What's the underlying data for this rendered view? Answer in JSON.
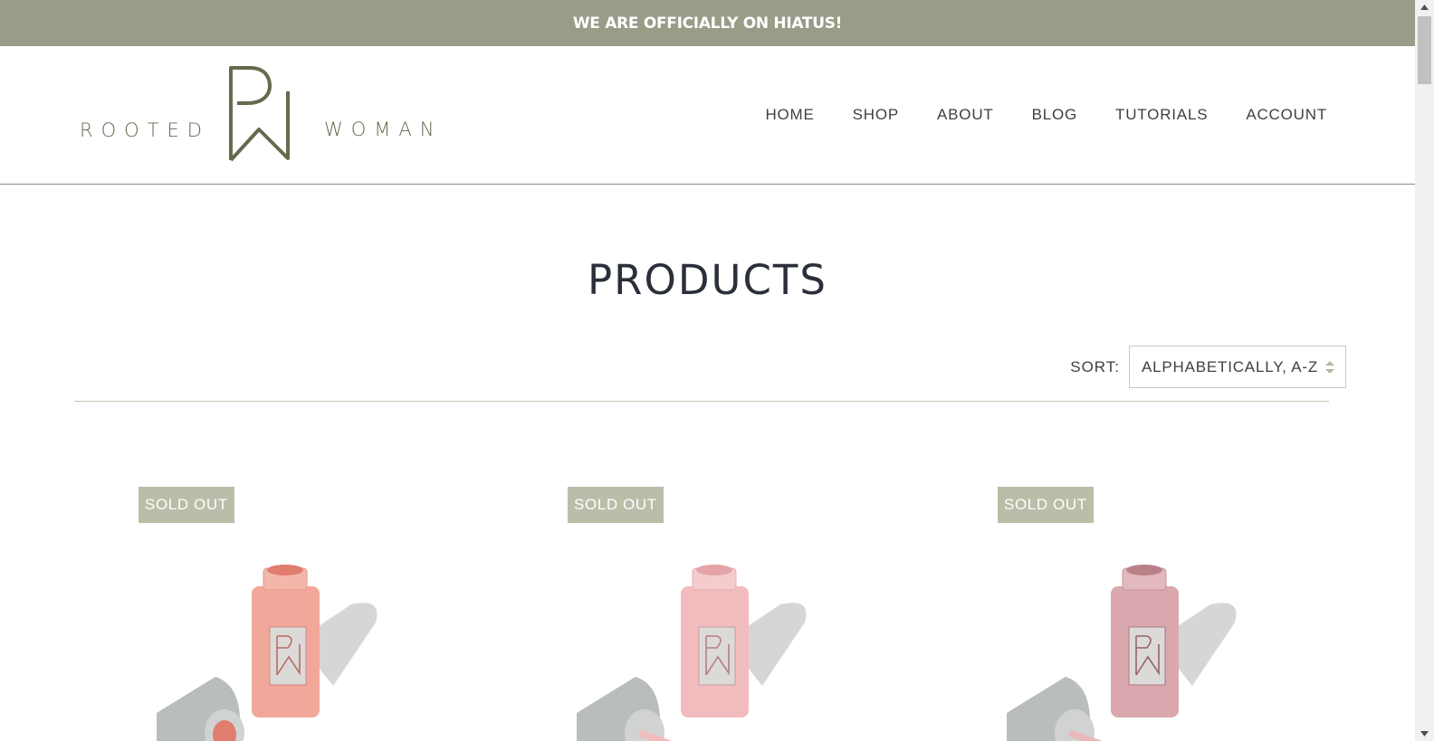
{
  "announcement": {
    "text": "WE ARE OFFICIALLY ON HIATUS!"
  },
  "logo": {
    "left_word": "ROOTED",
    "right_word": "WOMAN"
  },
  "nav": [
    {
      "label": "HOME"
    },
    {
      "label": "SHOP"
    },
    {
      "label": "ABOUT"
    },
    {
      "label": "BLOG"
    },
    {
      "label": "TUTORIALS"
    },
    {
      "label": "ACCOUNT"
    }
  ],
  "page": {
    "title": "PRODUCTS"
  },
  "sort": {
    "label": "SORT:",
    "selected": "ALPHABETICALLY, A-Z"
  },
  "products": [
    {
      "badge": "SOLD OUT",
      "polish_color": "#f1a89a",
      "cap": "silver-cap"
    },
    {
      "badge": "SOLD OUT",
      "polish_color": "#f1bcbe",
      "cap": "silver-cap"
    },
    {
      "badge": "SOLD OUT",
      "polish_color": "#d8a8ae",
      "cap": "silver-cap"
    }
  ],
  "colors": {
    "accent": "#999c86",
    "badge": "#bbbda9",
    "logo": "#656a4e",
    "title": "#2b2f3a"
  }
}
